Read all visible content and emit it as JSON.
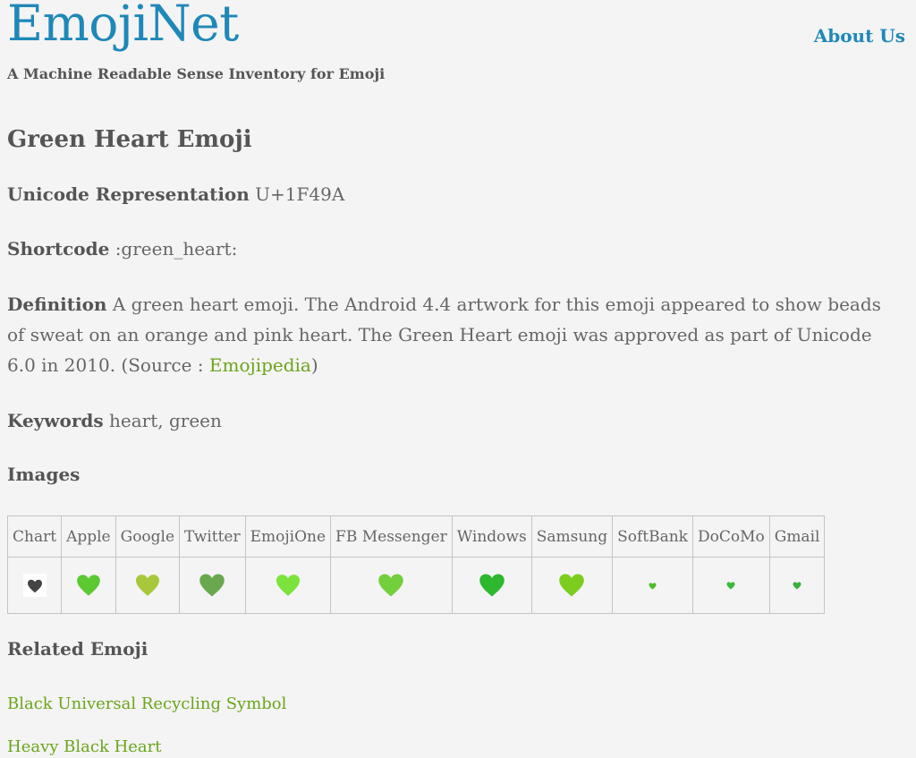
{
  "site": {
    "brand": "EmojiNet",
    "tagline": "A Machine Readable Sense Inventory for Emoji",
    "about_link": "About Us"
  },
  "emoji": {
    "title": "Green Heart Emoji",
    "unicode_label": "Unicode Representation",
    "unicode_value": "U+1F49A",
    "shortcode_label": "Shortcode",
    "shortcode_value": ":green_heart:",
    "definition_label": "Definition",
    "definition_text": "A green heart emoji. The Android 4.4 artwork for this emoji appeared to show beads of sweat on an orange and pink heart. The Green Heart emoji was approved as part of Unicode 6.0 in 2010. (Source : ",
    "definition_source": "Emojipedia",
    "definition_close": ")",
    "keywords_label": "Keywords",
    "keywords_value": "heart, green"
  },
  "images": {
    "heading": "Images",
    "vendors": [
      "Chart",
      "Apple",
      "Google",
      "Twitter",
      "EmojiOne",
      "FB Messenger",
      "Windows",
      "Samsung",
      "SoftBank",
      "DoCoMo",
      "Gmail"
    ],
    "heart_colors": [
      "#444444",
      "#5cc832",
      "#a8c83c",
      "#6aa84f",
      "#7be33c",
      "#74cf3c",
      "#2eb82e",
      "#7ccd1e",
      "#4cbd2a",
      "#3bb83b",
      "#3ab03a"
    ]
  },
  "related": {
    "heading": "Related Emoji",
    "items": [
      "Black Universal Recycling Symbol",
      "Heavy Black Heart"
    ]
  }
}
